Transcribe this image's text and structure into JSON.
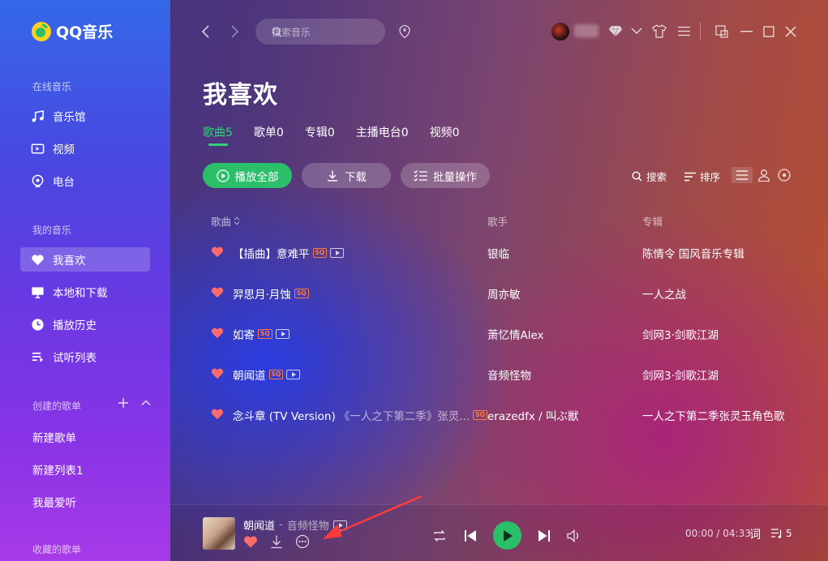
{
  "app": {
    "logo_text": "QQ音乐"
  },
  "sidebar": {
    "online_label": "在线音乐",
    "online_items": [
      {
        "label": "音乐馆",
        "icon": "music-note-icon"
      },
      {
        "label": "视频",
        "icon": "video-icon"
      },
      {
        "label": "电台",
        "icon": "radio-icon"
      }
    ],
    "mine_label": "我的音乐",
    "mine_items": [
      {
        "label": "我喜欢",
        "icon": "heart-icon",
        "active": true
      },
      {
        "label": "本地和下载",
        "icon": "monitor-icon"
      },
      {
        "label": "播放历史",
        "icon": "clock-icon"
      },
      {
        "label": "试听列表",
        "icon": "playlist-icon"
      }
    ],
    "created_label": "创建的歌单",
    "created_playlists": [
      "新建歌单",
      "新建列表1",
      "我最爱听"
    ],
    "collected_label": "收藏的歌单"
  },
  "topbar": {
    "search_placeholder": "搜索音乐"
  },
  "page": {
    "title": "我喜欢",
    "tabs": [
      "歌曲5",
      "歌单0",
      "专辑0",
      "主播电台0",
      "视频0"
    ],
    "actions": {
      "play_all": "播放全部",
      "download": "下载",
      "batch": "批量操作"
    },
    "tools": {
      "search": "搜索",
      "sort": "排序"
    },
    "columns": {
      "song": "歌曲",
      "artist": "歌手",
      "album": "专辑"
    },
    "songs": [
      {
        "title": "【插曲】意难平",
        "sub": "",
        "sq": "SQ",
        "mv": true,
        "artist": "银临",
        "album": "陈情令 国风音乐专辑"
      },
      {
        "title": "羿思月·月蚀",
        "sub": "",
        "sq": "SQ",
        "mv": false,
        "artist": "周亦敏",
        "album": "一人之战"
      },
      {
        "title": "如寄",
        "sub": "",
        "sq": "SQ",
        "mv": true,
        "artist": "萧忆情Alex",
        "album": "剑网3·剑歌江湖"
      },
      {
        "title": "朝闻道",
        "sub": "",
        "sq": "SQ",
        "mv": true,
        "artist": "音频怪物",
        "album": "剑网3·剑歌江湖"
      },
      {
        "title": "念斗章 (TV Version)",
        "sub": "《一人之下第二季》张灵...",
        "sq": "SQ",
        "mv": false,
        "artist": "erazedfx / 叫ぶ獣",
        "album": "一人之下第二季张灵玉角色歌"
      }
    ]
  },
  "player": {
    "title": "朝闻道",
    "separator": "-",
    "artist": "音频怪物",
    "time": "00:00 / 04:33",
    "lyric_label": "词",
    "queue_count": "5"
  },
  "colors": {
    "accent": "#2cbf6a",
    "sq": "#ff7a3c",
    "heart": "#ff6b6b",
    "annotation_arrow": "#ff3b3b"
  }
}
